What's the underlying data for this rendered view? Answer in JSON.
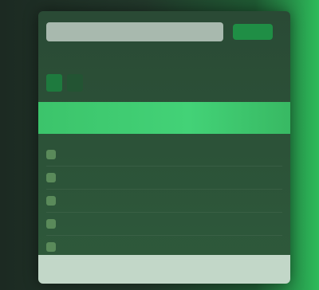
{
  "window": {
    "title": "",
    "action_label": ""
  },
  "tabs": [
    {
      "label": ""
    },
    {
      "label": ""
    }
  ],
  "highlight": {
    "label": ""
  },
  "list": [
    {
      "label": "",
      "value": ""
    },
    {
      "label": "",
      "value": ""
    },
    {
      "label": "",
      "value": ""
    },
    {
      "label": "",
      "value": ""
    },
    {
      "label": "",
      "value": ""
    }
  ],
  "footer": {
    "text": ""
  },
  "colors": {
    "accent": "#3cc46b",
    "window_bg": "#2a4a35",
    "background_right": "#2dbb5a"
  }
}
